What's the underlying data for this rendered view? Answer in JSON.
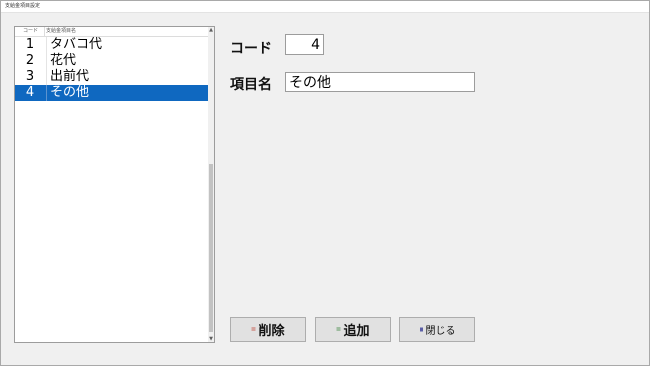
{
  "window": {
    "title": "支給金項目設定"
  },
  "list": {
    "headers": {
      "code": "コード",
      "name": "支給金項目名"
    },
    "rows": [
      {
        "code": "1",
        "name": "タバコ代"
      },
      {
        "code": "2",
        "name": "花代"
      },
      {
        "code": "3",
        "name": "出前代"
      },
      {
        "code": "4",
        "name": "その他"
      }
    ],
    "selected_index": 3
  },
  "form": {
    "code_label": "コード",
    "code_value": "4",
    "name_label": "項目名",
    "name_value": "その他"
  },
  "buttons": {
    "delete_label": "削除",
    "add_label": "追加",
    "close_label": "閉じる"
  },
  "colors": {
    "selection": "#0f68c0",
    "background": "#f0f0f0"
  }
}
